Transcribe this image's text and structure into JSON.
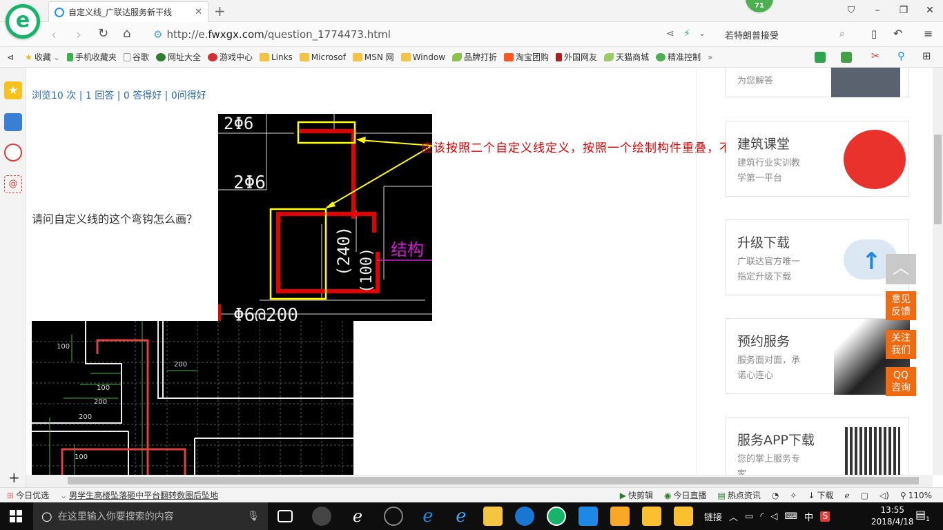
{
  "browser": {
    "tab_title": "自定义线_广联达服务新干线",
    "url_prefix": "http://e.",
    "url_domain": "fwxgx.com",
    "url_path": "/question_1774473.html",
    "search_text": "若特朗普接受",
    "badge_count": "71"
  },
  "bookmarks": [
    {
      "label": "收藏",
      "icon": "star-icon"
    },
    {
      "label": "手机收藏夹",
      "icon": "phone-icon"
    },
    {
      "label": "谷歌",
      "icon": "page-icon"
    },
    {
      "label": "网址大全",
      "icon": "globe-icon"
    },
    {
      "label": "游戏中心",
      "icon": "game-icon"
    },
    {
      "label": "Links",
      "icon": "folder-icon"
    },
    {
      "label": "Microsof",
      "icon": "folder-icon"
    },
    {
      "label": "MSN 网",
      "icon": "folder-icon"
    },
    {
      "label": "Window",
      "icon": "folder-icon"
    },
    {
      "label": "品牌打折",
      "icon": "leaf-icon"
    },
    {
      "label": "淘宝团购",
      "icon": "taobao-icon"
    },
    {
      "label": "外国网友",
      "icon": "bookmark-icon"
    },
    {
      "label": "天猫商城",
      "icon": "leaf-icon"
    },
    {
      "label": "精准控制",
      "icon": "chat-icon"
    }
  ],
  "page": {
    "stats": "浏览10 次 | 1 回答 | 0 答得好 | 0问得好",
    "question": "请问自定义线的这个弯钩怎么画？",
    "annotation": "应该按照二个自定义线定义，按照一个绘制构件重叠，不能布置",
    "img1_labels": {
      "top": "2Φ6",
      "mid": "2Φ6",
      "dim1": "(240)",
      "dim2": "(100)",
      "purple": "结构",
      "bottom": "Φ6@200"
    },
    "img2_labels": [
      "100",
      "100",
      "100",
      "200",
      "200",
      "200",
      "100"
    ]
  },
  "sidebar_cards": [
    {
      "title": "",
      "subtitle": "为您解答"
    },
    {
      "title": "建筑课堂",
      "subtitle": "建筑行业实训教|学第一平台"
    },
    {
      "title": "升级下载",
      "subtitle": "广联达官方唯一|指定升级下载"
    },
    {
      "title": "预约服务",
      "subtitle": "服务面对面，承|诺心连心"
    },
    {
      "title": "服务APP下载",
      "subtitle": "您的掌上服务专|家"
    }
  ],
  "float_buttons": [
    "意见反馈",
    "关注我们",
    "QQ咨询"
  ],
  "status_bar": {
    "today": "今日优选",
    "news": "男学生高楼坠落砸中平台翻转数圈后坠地",
    "quick_cut": "快剪辑",
    "live": "今日直播",
    "hot": "热点资讯",
    "download": "下载",
    "zoom": "110%"
  },
  "taskbar": {
    "search_placeholder": "在这里输入你要搜索的内容",
    "tray_link": "链接",
    "ime": "中",
    "time": "13:55",
    "date": "2018/4/18",
    "notification_count": "1"
  }
}
